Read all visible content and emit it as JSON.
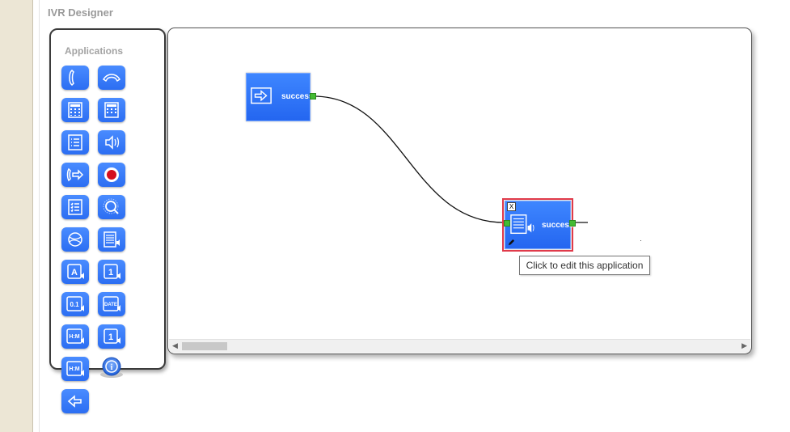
{
  "page": {
    "title": "IVR Designer"
  },
  "palette": {
    "title": "Applications",
    "date_label": "DATE",
    "hm_label": "H:M",
    "one_label": "1",
    "a_label": "A",
    "decimal_label": "0.1",
    "info_label": "i"
  },
  "canvas": {
    "start_node": {
      "port_label": "success"
    },
    "app_node": {
      "port_label": "success",
      "close_label": "X"
    },
    "tooltip": "Click to edit this application"
  }
}
